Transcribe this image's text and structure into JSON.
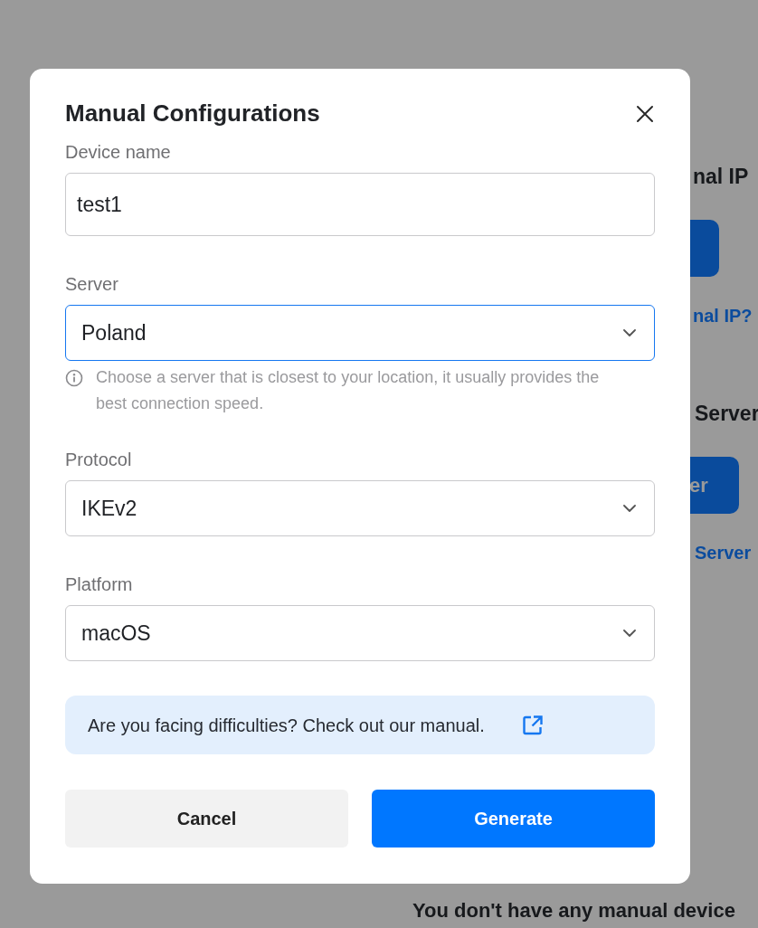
{
  "background": {
    "sections": [
      {
        "heading": "nal IP",
        "link": "nal IP?"
      },
      {
        "heading": "Server",
        "button": "er",
        "link": "Server"
      }
    ],
    "empty_message": "You don't have any manual device"
  },
  "modal": {
    "title": "Manual Configurations",
    "fields": [
      {
        "kind": "input",
        "label": "Device name",
        "value": "test1",
        "focused": false
      },
      {
        "kind": "select",
        "label": "Server",
        "value": "Poland",
        "focused": true,
        "hint": "Choose a server that is closest to your location, it usually provides the best connection speed."
      },
      {
        "kind": "select",
        "label": "Protocol",
        "value": "IKEv2",
        "focused": false
      },
      {
        "kind": "select",
        "label": "Platform",
        "value": "macOS",
        "focused": false
      }
    ],
    "notice": {
      "text": "Are you facing difficulties? Check out our manual."
    },
    "buttons": [
      {
        "label": "Cancel",
        "kind": "secondary"
      },
      {
        "label": "Generate",
        "kind": "primary"
      }
    ]
  }
}
